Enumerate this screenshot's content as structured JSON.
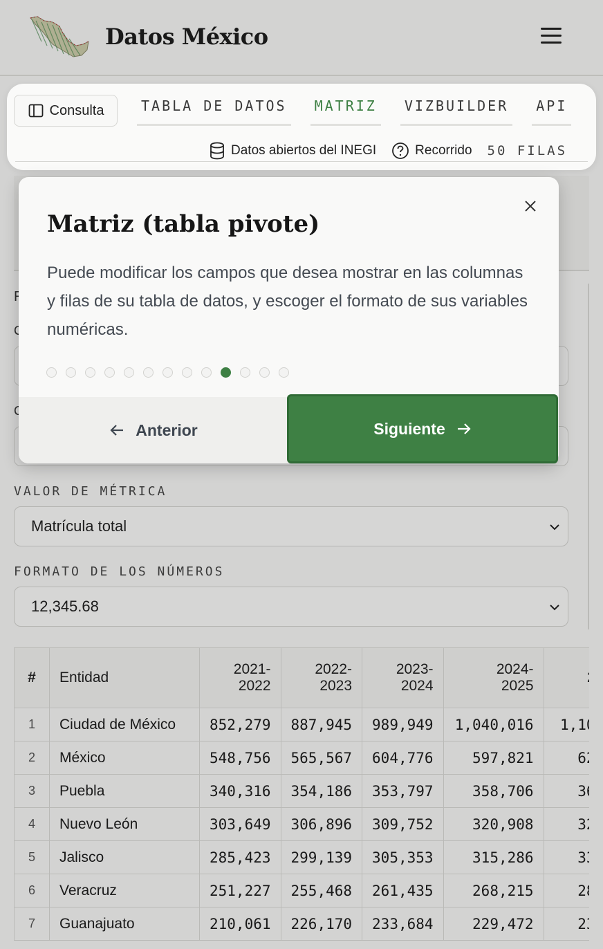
{
  "header": {
    "brand": "Datos México",
    "logo_icon": "mexico-map-logo-icon",
    "menu_icon": "hamburger-menu-icon"
  },
  "toolbar": {
    "consulta_label": "Consulta",
    "tabs": [
      {
        "label": "TABLA DE DATOS",
        "active": false
      },
      {
        "label": "MATRIZ",
        "active": true
      },
      {
        "label": "VIZBUILDER",
        "active": false
      },
      {
        "label": "API",
        "active": false
      }
    ],
    "source_label": "Datos abiertos del INEGI",
    "tour_label": "Recorrido",
    "rows_label": "50 FILAS"
  },
  "background": {
    "frag_r": "R",
    "frag_c1": "C",
    "frag_c2": "C",
    "metric_label": "VALOR DE MÉTRICA",
    "metric_value": "Matrícula total",
    "format_label": "FORMATO DE LOS NÚMEROS",
    "format_value": "12,345.68"
  },
  "table": {
    "headers": [
      "#",
      "Entidad",
      "2021-\n2022",
      "2022-\n2023",
      "2023-\n2024",
      "2024-\n2025",
      "2"
    ],
    "rows": [
      [
        "1",
        "Ciudad de México",
        "852,279",
        "887,945",
        "989,949",
        "1,040,016",
        "1,10"
      ],
      [
        "2",
        "México",
        "548,756",
        "565,567",
        "604,776",
        "597,821",
        "62"
      ],
      [
        "3",
        "Puebla",
        "340,316",
        "354,186",
        "353,797",
        "358,706",
        "36"
      ],
      [
        "4",
        "Nuevo León",
        "303,649",
        "306,896",
        "309,752",
        "320,908",
        "32"
      ],
      [
        "5",
        "Jalisco",
        "285,423",
        "299,139",
        "305,353",
        "315,286",
        "33"
      ],
      [
        "6",
        "Veracruz",
        "251,227",
        "255,468",
        "261,435",
        "268,215",
        "28"
      ],
      [
        "7",
        "Guanajuato",
        "210,061",
        "226,170",
        "233,684",
        "229,472",
        "23"
      ]
    ]
  },
  "modal": {
    "title": "Matriz (tabla pivote)",
    "body": "Puede modificar los campos que desea mostrar en las columnas y filas de su tabla de datos, y escoger el formato de sus variables numéricas.",
    "step_count": 13,
    "current_step": 10,
    "prev_label": "Anterior",
    "next_label": "Siguiente",
    "accent_color": "#3e8044"
  }
}
